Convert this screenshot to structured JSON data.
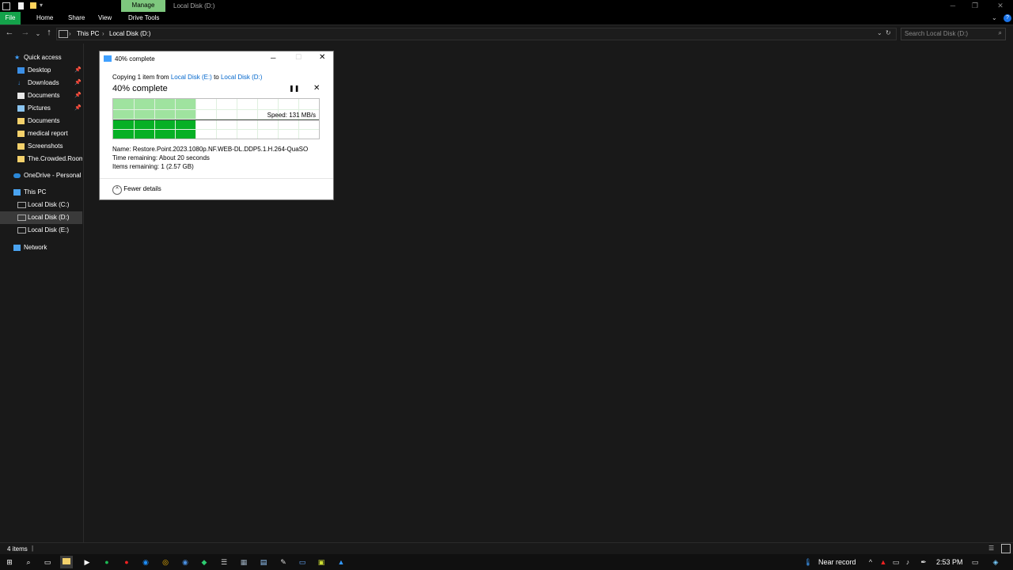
{
  "window": {
    "title": "Local Disk (D:)",
    "manage_tab": "Manage",
    "ribbon_tabs": [
      "File",
      "Home",
      "Share",
      "View",
      "Drive Tools"
    ],
    "breadcrumb": [
      "This PC",
      "Local Disk (D:)"
    ],
    "search_placeholder": "Search Local Disk (D:)"
  },
  "sidebar": {
    "quick_access": "Quick access",
    "items": [
      {
        "label": "Desktop",
        "pinned": true,
        "icon": "desktop-icon"
      },
      {
        "label": "Downloads",
        "pinned": true,
        "icon": "download-icon"
      },
      {
        "label": "Documents",
        "pinned": true,
        "icon": "documents-icon"
      },
      {
        "label": "Pictures",
        "pinned": true,
        "icon": "pictures-icon"
      },
      {
        "label": "Documents",
        "pinned": false,
        "icon": "folder-icon"
      },
      {
        "label": "medical report",
        "pinned": false,
        "icon": "folder-icon"
      },
      {
        "label": "Screenshots",
        "pinned": false,
        "icon": "folder-icon"
      },
      {
        "label": "The.Crowded.Room",
        "pinned": false,
        "icon": "folder-icon"
      }
    ],
    "onedrive": "OneDrive - Personal",
    "this_pc": "This PC",
    "drives": [
      "Local Disk (C:)",
      "Local Disk (D:)",
      "Local Disk (E:)"
    ],
    "network": "Network"
  },
  "dialog": {
    "title": "40% complete",
    "copying_prefix": "Copying 1 item from",
    "source": "Local Disk (E:)",
    "to_word": "to",
    "destination": "Local Disk (D:)",
    "heading": "40% complete",
    "progress_fraction": 0.4,
    "speed": "Speed: 131 MB/s",
    "name_label": "Name:",
    "name_value": "Restore.Point.2023.1080p.NF.WEB-DL.DDP5.1.H.264-QuaSO",
    "time_label": "Time remaining:",
    "time_value": "About 20 seconds",
    "items_label": "Items remaining:",
    "items_value": "1 (2.57 GB)",
    "fewer_details": "Fewer details"
  },
  "status": {
    "items_count": "4 items"
  },
  "taskbar": {
    "weather": "Near record",
    "time": "2:53 PM"
  },
  "colors": {
    "progress": "#06b025",
    "progress_light": "#9fe39f",
    "accent": "#0066cc",
    "file_tab": "#14a24a"
  }
}
